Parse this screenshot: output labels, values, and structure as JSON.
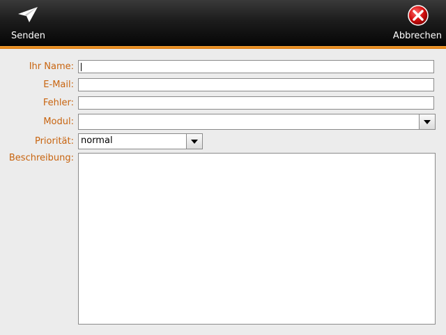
{
  "toolbar": {
    "send_label": "Senden",
    "cancel_label": "Abbrechen",
    "accent_color": "#e8850f"
  },
  "form": {
    "name_label": "Ihr Name:",
    "name_value": "",
    "email_label": "E-Mail:",
    "email_value": "",
    "error_label": "Fehler:",
    "error_value": "",
    "module_label": "Modul:",
    "module_value": "",
    "priority_label": "Priorität:",
    "priority_value": "normal",
    "description_label": "Beschreibung:",
    "description_value": "",
    "label_color": "#c8640f"
  }
}
